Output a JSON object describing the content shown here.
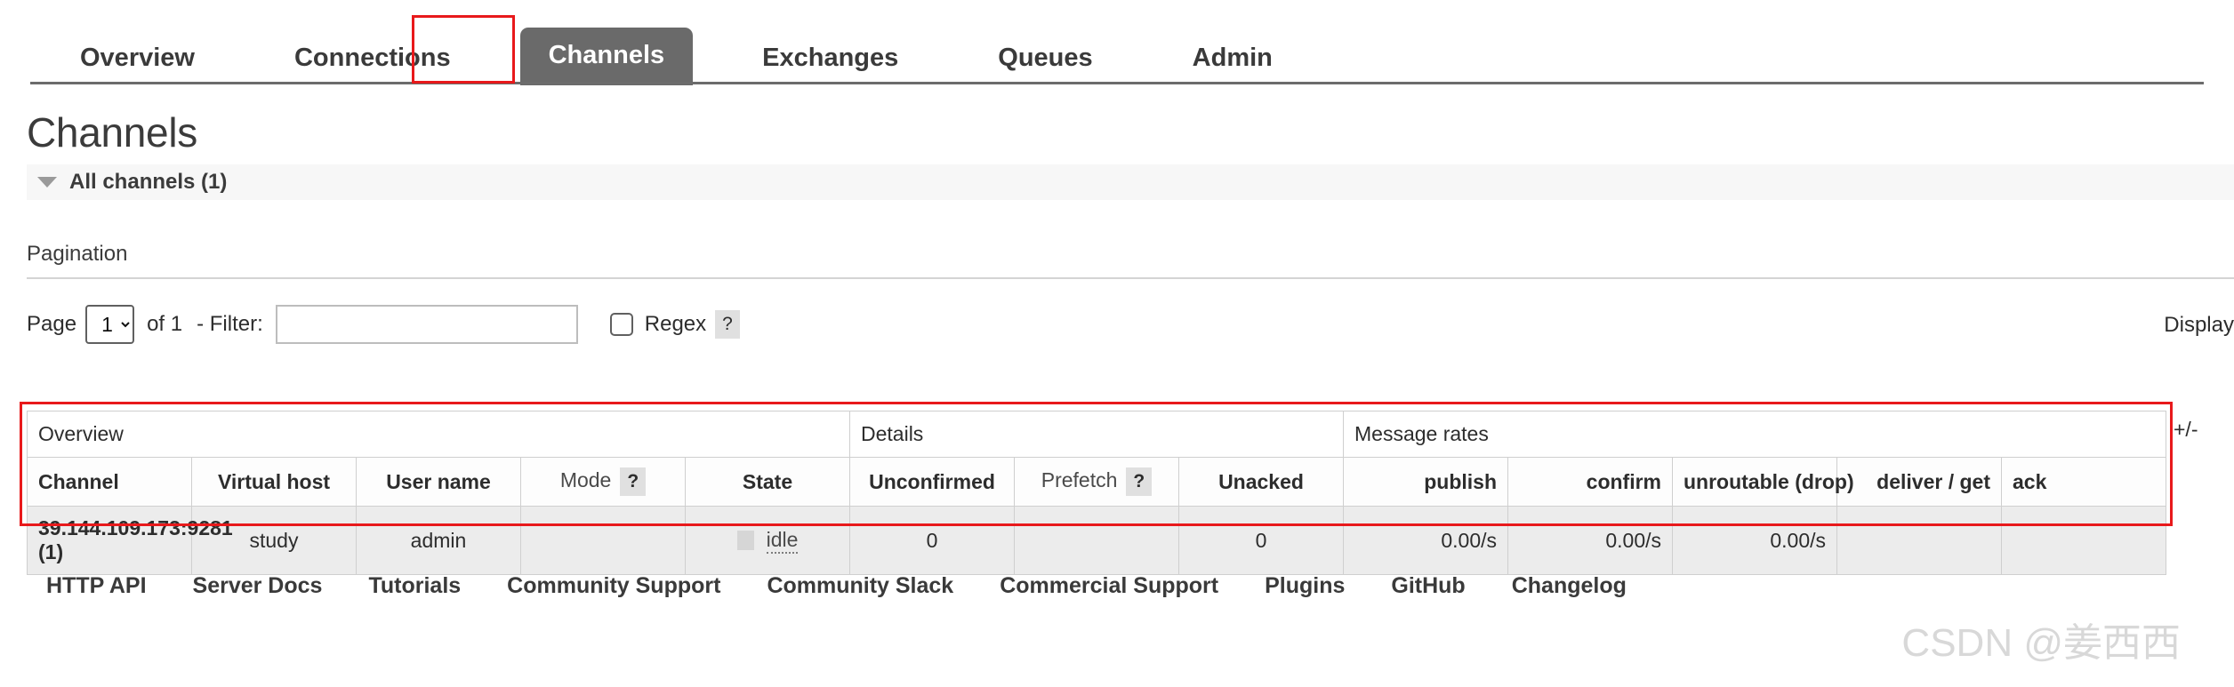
{
  "nav": {
    "items": [
      {
        "label": "Overview",
        "active": false
      },
      {
        "label": "Connections",
        "active": false
      },
      {
        "label": "Channels",
        "active": true
      },
      {
        "label": "Exchanges",
        "active": false
      },
      {
        "label": "Queues",
        "active": false
      },
      {
        "label": "Admin",
        "active": false
      }
    ],
    "active_tab": "Channels",
    "highlight_color": "#e8191b",
    "active_bg": "#6a6a6a"
  },
  "page": {
    "title": "Channels"
  },
  "section": {
    "all_channels_label": "All channels (1)",
    "toggle_icon": "triangle-down-icon"
  },
  "pagination": {
    "heading": "Pagination",
    "page_label": "Page",
    "page_value": "1",
    "page_options": [
      "1"
    ],
    "of_label": "of 1",
    "filter_label": "- Filter:",
    "filter_value": "",
    "filter_placeholder": "",
    "regex_label": "Regex",
    "regex_checked": false,
    "regex_help": "?",
    "display_label": "Display"
  },
  "table": {
    "groups": [
      {
        "label": "Overview",
        "span": 5
      },
      {
        "label": "Details",
        "span": 3
      },
      {
        "label": "Message rates",
        "span": 5
      }
    ],
    "columns": [
      {
        "label": "Channel",
        "align": "left",
        "bold": true,
        "help": false
      },
      {
        "label": "Virtual host",
        "align": "center",
        "bold": true,
        "help": false
      },
      {
        "label": "User name",
        "align": "center",
        "bold": true,
        "help": false
      },
      {
        "label": "Mode",
        "align": "center",
        "bold": false,
        "help": true
      },
      {
        "label": "State",
        "align": "center",
        "bold": true,
        "help": false
      },
      {
        "label": "Unconfirmed",
        "align": "center",
        "bold": true,
        "help": false
      },
      {
        "label": "Prefetch",
        "align": "center",
        "bold": false,
        "help": true
      },
      {
        "label": "Unacked",
        "align": "center",
        "bold": true,
        "help": false
      },
      {
        "label": "publish",
        "align": "right",
        "bold": true,
        "help": false
      },
      {
        "label": "confirm",
        "align": "right",
        "bold": true,
        "help": false
      },
      {
        "label": "unroutable (drop)",
        "align": "right",
        "bold": true,
        "help": false
      },
      {
        "label": "deliver / get",
        "align": "right",
        "bold": true,
        "help": false
      },
      {
        "label": "ack",
        "align": "left",
        "bold": true,
        "help": false
      }
    ],
    "rows": [
      {
        "channel": "39.144.109.173:9281 (1)",
        "virtual_host": "study",
        "user_name": "admin",
        "mode": "",
        "state": "idle",
        "state_swatch": "#d6d6d6",
        "unconfirmed": "0",
        "prefetch": "",
        "unacked": "0",
        "publish": "0.00/s",
        "confirm": "0.00/s",
        "unroutable_drop": "0.00/s",
        "deliver_get": "",
        "ack": ""
      }
    ],
    "column_toggle": "+/-",
    "help_badge": "?"
  },
  "footer": {
    "links": [
      "HTTP API",
      "Server Docs",
      "Tutorials",
      "Community Support",
      "Community Slack",
      "Commercial Support",
      "Plugins",
      "GitHub",
      "Changelog"
    ]
  },
  "watermark": {
    "text": "CSDN @姜西西"
  }
}
